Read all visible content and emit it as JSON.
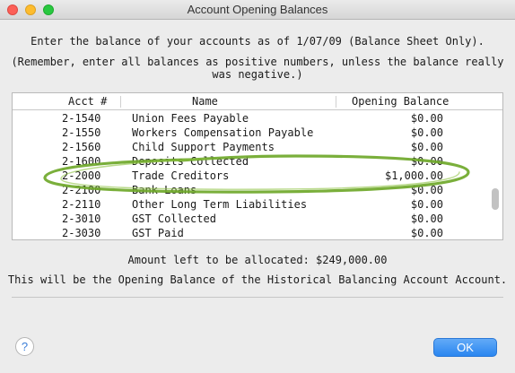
{
  "window": {
    "title": "Account Opening Balances"
  },
  "instructions": {
    "line1": "Enter the balance of your accounts as of 1/07/09 (Balance Sheet Only).",
    "line2": "(Remember, enter all balances as positive numbers, unless the balance really was negative.)"
  },
  "table": {
    "columns": [
      "Acct #",
      "Name",
      "Opening Balance"
    ],
    "rows": [
      {
        "acct": "2-1540",
        "name": "Union Fees Payable",
        "balance": "$0.00"
      },
      {
        "acct": "2-1550",
        "name": "Workers Compensation Payable",
        "balance": "$0.00"
      },
      {
        "acct": "2-1560",
        "name": "Child Support Payments",
        "balance": "$0.00"
      },
      {
        "acct": "2-1600",
        "name": "Deposits Collected",
        "balance": "$0.00"
      },
      {
        "acct": "2-2000",
        "name": "Trade Creditors",
        "balance": "$1,000.00"
      },
      {
        "acct": "2-2100",
        "name": "Bank Loans",
        "balance": "$0.00"
      },
      {
        "acct": "2-2110",
        "name": "Other Long Term Liabilities",
        "balance": "$0.00"
      },
      {
        "acct": "2-3010",
        "name": "GST Collected",
        "balance": "$0.00"
      },
      {
        "acct": "2-3030",
        "name": "GST Paid",
        "balance": "$0.00"
      }
    ],
    "highlight_color": "#6fa82a"
  },
  "summary": {
    "amount_left": "Amount left to be allocated:  $249,000.00",
    "explanation": "This will be the Opening Balance of the Historical Balancing Account Account."
  },
  "buttons": {
    "help": "?",
    "ok": "OK"
  }
}
